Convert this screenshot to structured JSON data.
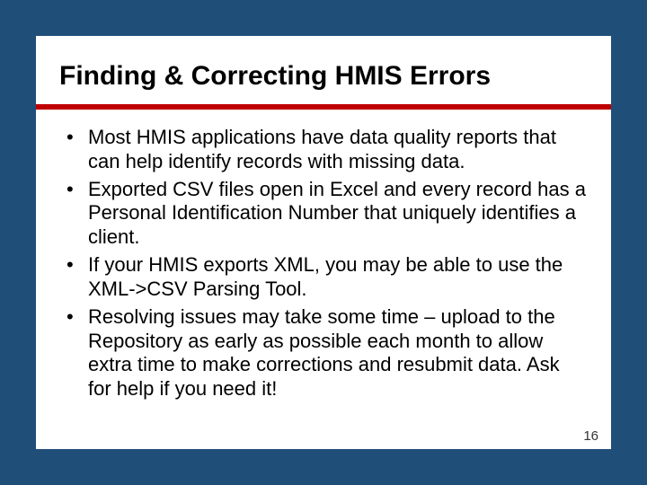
{
  "slide": {
    "title": "Finding & Correcting HMIS Errors",
    "bullets": [
      "Most HMIS applications have data quality reports that can help identify records with missing data.",
      "Exported CSV files open in Excel and every record has a Personal Identification Number that uniquely identifies a client.",
      "If your HMIS exports XML, you may be able to use the XML->CSV Parsing Tool.",
      "Resolving issues may take some time – upload to the Repository as early as possible each month to allow extra time to make corrections and resubmit data.  Ask for help if you need it!"
    ],
    "page_number": "16"
  },
  "colors": {
    "background": "#1f4e79",
    "rule": "#c00000"
  }
}
